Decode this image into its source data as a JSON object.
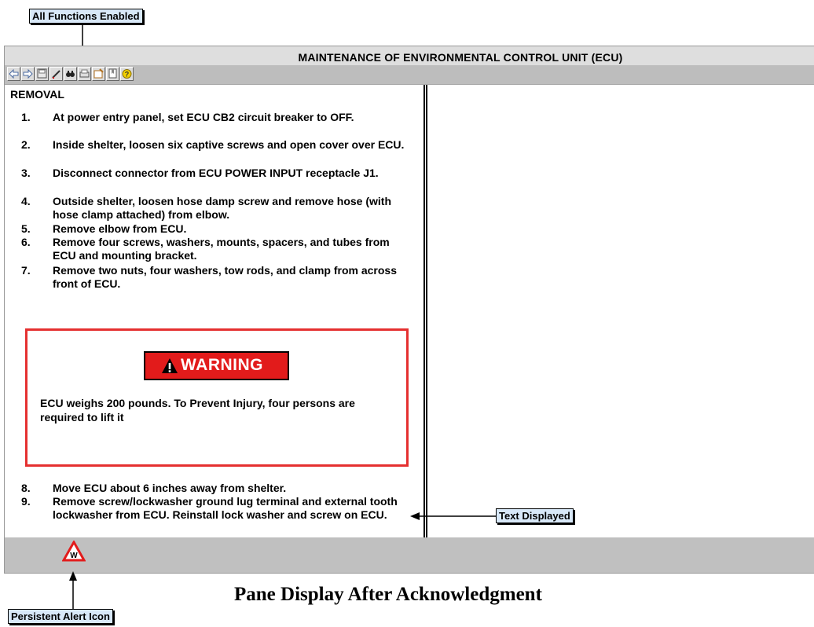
{
  "callouts": {
    "functions": "All Functions Enabled",
    "text_displayed": "Text Displayed",
    "alert_icon": "Persistent Alert Icon"
  },
  "window": {
    "title": "MAINTENANCE OF ENVIRONMENTAL CONTROL UNIT (ECU)"
  },
  "toolbar": {
    "buttons": [
      "back-icon",
      "forward-icon",
      "save-icon",
      "annotate-icon",
      "find-icon",
      "print-icon",
      "notes-icon",
      "bookmark-icon",
      "help-icon"
    ]
  },
  "content": {
    "heading": "REMOVAL",
    "steps_before": [
      {
        "num": "1.",
        "text": "At power entry panel, set ECU CB2 circuit breaker to OFF."
      },
      {
        "num": "2.",
        "text": "Inside shelter, loosen six captive screws and open cover over ECU."
      },
      {
        "num": "3.",
        "text": "Disconnect connector from ECU POWER INPUT receptacle J1."
      },
      {
        "num": "4.",
        "text": "Outside shelter, loosen hose damp screw and remove hose (with hose clamp attached) from elbow."
      },
      {
        "num": "5.",
        "text": "Remove elbow from ECU."
      },
      {
        "num": "6.",
        "text": "Remove four screws, washers, mounts, spacers, and tubes from ECU and mounting bracket."
      },
      {
        "num": "7.",
        "text": "Remove two nuts, four washers, tow rods, and clamp from across front of ECU."
      }
    ],
    "warning": {
      "label": "WARNING",
      "text": "ECU weighs 200 pounds. To Prevent Injury, four persons are required to lift it"
    },
    "steps_after": [
      {
        "num": "8.",
        "text": "Move ECU about 6 inches away from shelter."
      },
      {
        "num": "9.",
        "text": "Remove screw/lockwasher ground lug terminal and external tooth lockwasher from ECU. Reinstall lock washer and screw on ECU."
      }
    ]
  },
  "status": {
    "alert_icon_letter": "W"
  },
  "caption": "Pane Display After Acknowledgment",
  "colors": {
    "warning_red": "#e21b1b",
    "callout_bg": "#d8e8f8",
    "toolbar_gray": "#bdbdbd"
  }
}
